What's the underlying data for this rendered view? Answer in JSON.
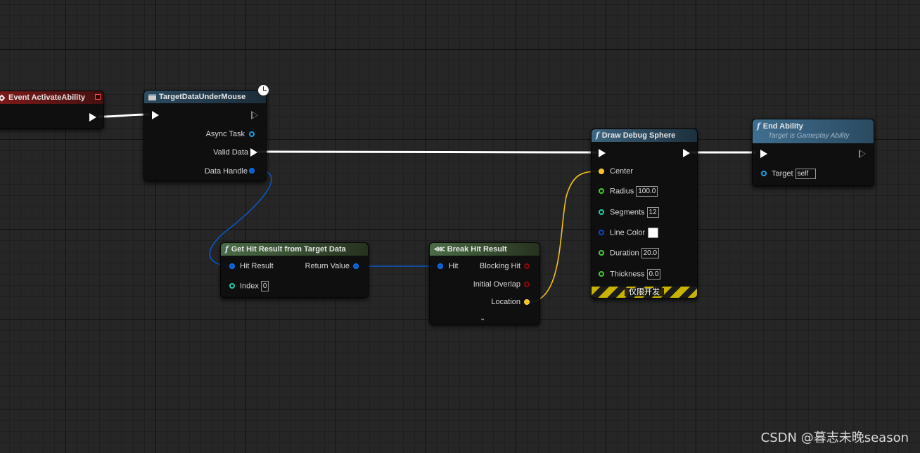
{
  "nodes": {
    "event": {
      "title": "Event ActivateAbility"
    },
    "target_data": {
      "title": "TargetDataUnderMouse",
      "pins": {
        "async_task": "Async Task",
        "valid_data": "Valid Data",
        "data_handle": "Data Handle"
      }
    },
    "get_hit": {
      "title": "Get Hit Result from Target Data",
      "pins": {
        "hit_result": "Hit Result",
        "return_value": "Return Value",
        "index": "Index"
      },
      "index_value": "0"
    },
    "break_hit": {
      "title": "Break Hit Result",
      "pins": {
        "hit": "Hit",
        "blocking_hit": "Blocking Hit",
        "initial_overlap": "Initial Overlap",
        "location": "Location"
      }
    },
    "draw_sphere": {
      "title": "Draw Debug Sphere",
      "pins": {
        "center": "Center",
        "radius": "Radius",
        "radius_value": "100.0",
        "segments": "Segments",
        "segments_value": "12",
        "line_color": "Line Color",
        "duration": "Duration",
        "duration_value": "20.0",
        "thickness": "Thickness",
        "thickness_value": "0.0"
      },
      "dev_only": "仅限开发"
    },
    "end_ability": {
      "title": "End Ability",
      "subtitle": "Target is Gameplay Ability",
      "pins": {
        "target": "Target",
        "target_value": "self"
      }
    }
  },
  "colors": {
    "exec": "#ffffff",
    "struct_pin": "#0a5cc8",
    "vector_pin": "#f4c01a",
    "float_pin": "#3fcf2c",
    "int_pin": "#1fd0a8",
    "bool_pin": "#8a0a0a",
    "object_pin": "#1aa0e6",
    "linear_color_pin": "#0a48c8"
  },
  "watermark": "CSDN @暮志未晚season"
}
